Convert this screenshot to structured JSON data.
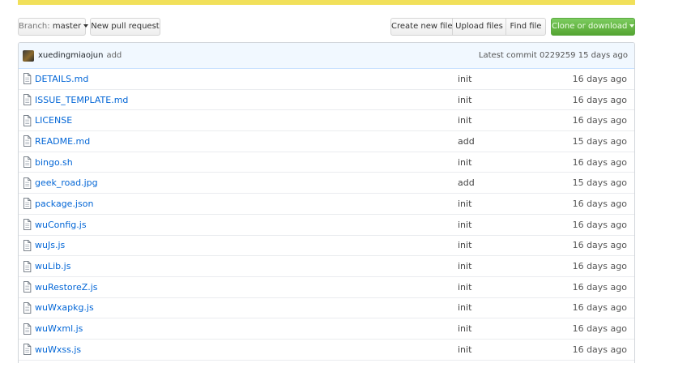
{
  "toolbar": {
    "branch_prefix": "Branch:",
    "branch_name": "master",
    "new_pull_request": "New pull request",
    "create_new_file": "Create new file",
    "upload_files": "Upload files",
    "find_file": "Find file",
    "clone_or_download": "Clone or download"
  },
  "commit": {
    "author": "xuedingmiaojun",
    "action": "add",
    "latest_label": "Latest commit",
    "sha": "0229259",
    "age": "15 days ago"
  },
  "files": [
    {
      "name": "DETAILS.md",
      "message": "init",
      "age": "16 days ago"
    },
    {
      "name": "ISSUE_TEMPLATE.md",
      "message": "init",
      "age": "16 days ago"
    },
    {
      "name": "LICENSE",
      "message": "init",
      "age": "16 days ago"
    },
    {
      "name": "README.md",
      "message": "add",
      "age": "15 days ago"
    },
    {
      "name": "bingo.sh",
      "message": "init",
      "age": "16 days ago"
    },
    {
      "name": "geek_road.jpg",
      "message": "add",
      "age": "15 days ago"
    },
    {
      "name": "package.json",
      "message": "init",
      "age": "16 days ago"
    },
    {
      "name": "wuConfig.js",
      "message": "init",
      "age": "16 days ago"
    },
    {
      "name": "wuJs.js",
      "message": "init",
      "age": "16 days ago"
    },
    {
      "name": "wuLib.js",
      "message": "init",
      "age": "16 days ago"
    },
    {
      "name": "wuRestoreZ.js",
      "message": "init",
      "age": "16 days ago"
    },
    {
      "name": "wuWxapkg.js",
      "message": "init",
      "age": "16 days ago"
    },
    {
      "name": "wuWxml.js",
      "message": "init",
      "age": "16 days ago"
    },
    {
      "name": "wuWxss.js",
      "message": "init",
      "age": "16 days ago"
    }
  ],
  "icons": {
    "file": "file-icon",
    "caret": "caret-down-icon",
    "avatar": "avatar"
  },
  "colors": {
    "link": "#0366d6",
    "clone_button": "#55a532",
    "commit_bar": "#f1f8ff",
    "language_bar": "#f1e05a"
  }
}
